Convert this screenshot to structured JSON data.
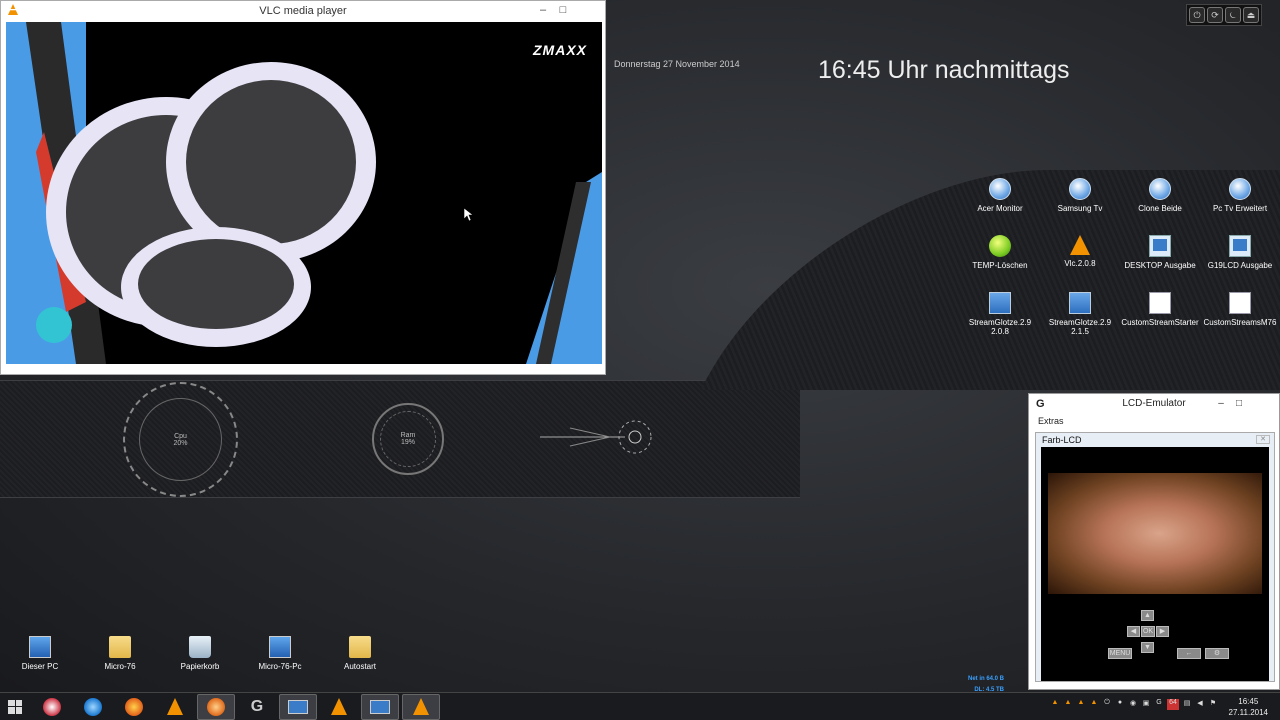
{
  "vlc": {
    "title": "VLC media player",
    "channel_logo": "ZMAXX",
    "minimize": "–",
    "maximize": "□"
  },
  "desktop": {
    "date": "Donnerstag 27 November 2014",
    "clock": "16:45 Uhr nachmittags",
    "icons_right": [
      {
        "label": "Acer Monitor",
        "icon": "vpn-globe-icon"
      },
      {
        "label": "Samsung Tv",
        "icon": "vpn-globe-icon"
      },
      {
        "label": "Clone Beide",
        "icon": "vpn-globe-icon"
      },
      {
        "label": "Pc Tv Erweitert",
        "icon": "vpn-globe-icon"
      },
      {
        "label": "TEMP-Löschen",
        "icon": "green-globe-icon"
      },
      {
        "label": "Vlc.2.0.8",
        "icon": "vlc-icon"
      },
      {
        "label": "DESKTOP Ausgabe",
        "icon": "shortcut-icon"
      },
      {
        "label": "G19LCD Ausgabe",
        "icon": "shortcut-icon"
      },
      {
        "label": "StreamGlotze.2.9 2.0.8",
        "icon": "monitor-icon"
      },
      {
        "label": "StreamGlotze.2.9 2.1.5",
        "icon": "monitor-icon"
      },
      {
        "label": "CustomStreamStarter",
        "icon": "document-icon"
      },
      {
        "label": "CustomStreamsM76",
        "icon": "document-icon"
      }
    ],
    "icons_bottom": [
      {
        "label": "Dieser PC",
        "icon": "pc-icon"
      },
      {
        "label": "Micro-76",
        "icon": "folder-icon"
      },
      {
        "label": "Papierkorb",
        "icon": "recycle-bin-icon"
      },
      {
        "label": "Micro-76-Pc",
        "icon": "pc-icon"
      },
      {
        "label": "Autostart",
        "icon": "folder-icon"
      }
    ]
  },
  "gauges": {
    "cpu_label": "Cpu",
    "cpu_value": "20%",
    "ram_label": "Ram",
    "ram_value": "19%"
  },
  "lcd": {
    "title": "LCD-Emulator",
    "menu": "Extras",
    "panel_title": "Farb-LCD",
    "menu_button": "MENU",
    "ok_button": "OK",
    "close": "✕"
  },
  "netstat": {
    "net_in": "Net in 64.0 B",
    "dl": "DL: 4.5 TB"
  },
  "taskbar": {
    "clock_time": "16:45",
    "clock_date": "27.11.2014",
    "tray_badge": "64"
  },
  "colors": {
    "vlc_orange": "#f39200",
    "net_blue": "#3aa0ff",
    "desktop_bg": "#25272b"
  }
}
